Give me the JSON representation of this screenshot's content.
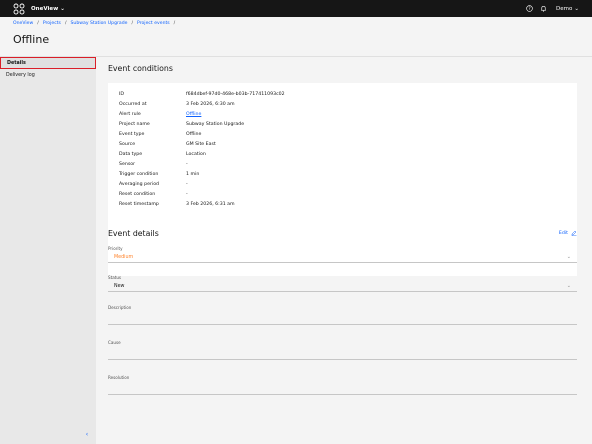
{
  "topbar": {
    "app_name": "OneView",
    "user_name": "Demo"
  },
  "breadcrumb": [
    "OneView",
    "Projects",
    "Subway Station Upgrade",
    "Project events"
  ],
  "page_title": "Offline",
  "sidebar": {
    "items": [
      {
        "label": "Details",
        "active": true
      },
      {
        "label": "Delivery log",
        "active": false
      }
    ]
  },
  "event_conditions": {
    "title": "Event conditions",
    "rows": [
      {
        "label": "ID",
        "value": "f684dbef-97d0-468e-b03b-717411093c02"
      },
      {
        "label": "Occurred at",
        "value": "3 Feb 2026, 6:30 am"
      },
      {
        "label": "Alert rule",
        "value": "Offline"
      },
      {
        "label": "Project name",
        "value": "Subway Station Upgrade"
      },
      {
        "label": "Event type",
        "value": "Offline"
      },
      {
        "label": "Source",
        "value": "GM Site East"
      },
      {
        "label": "Data type",
        "value": "Location"
      },
      {
        "label": "Sensor",
        "value": "-"
      },
      {
        "label": "Trigger condition",
        "value": "1 min"
      },
      {
        "label": "Averaging period",
        "value": "-"
      },
      {
        "label": "Reset condition",
        "value": "-"
      },
      {
        "label": "Reset timestamp",
        "value": "3 Feb 2026, 6:31 am"
      }
    ]
  },
  "event_details": {
    "title": "Event details",
    "edit_label": "Edit",
    "priority": {
      "label": "Priority",
      "value": "Medium"
    },
    "status": {
      "label": "Status",
      "value": "New"
    },
    "description": {
      "label": "Description",
      "value": ""
    },
    "cause": {
      "label": "Cause",
      "value": ""
    },
    "resolution": {
      "label": "Resolution",
      "value": ""
    }
  },
  "colors": {
    "accent": "#0f62fe",
    "topbar": "#161616",
    "priority_medium": "#ff832b",
    "focus": "#da1e28"
  }
}
